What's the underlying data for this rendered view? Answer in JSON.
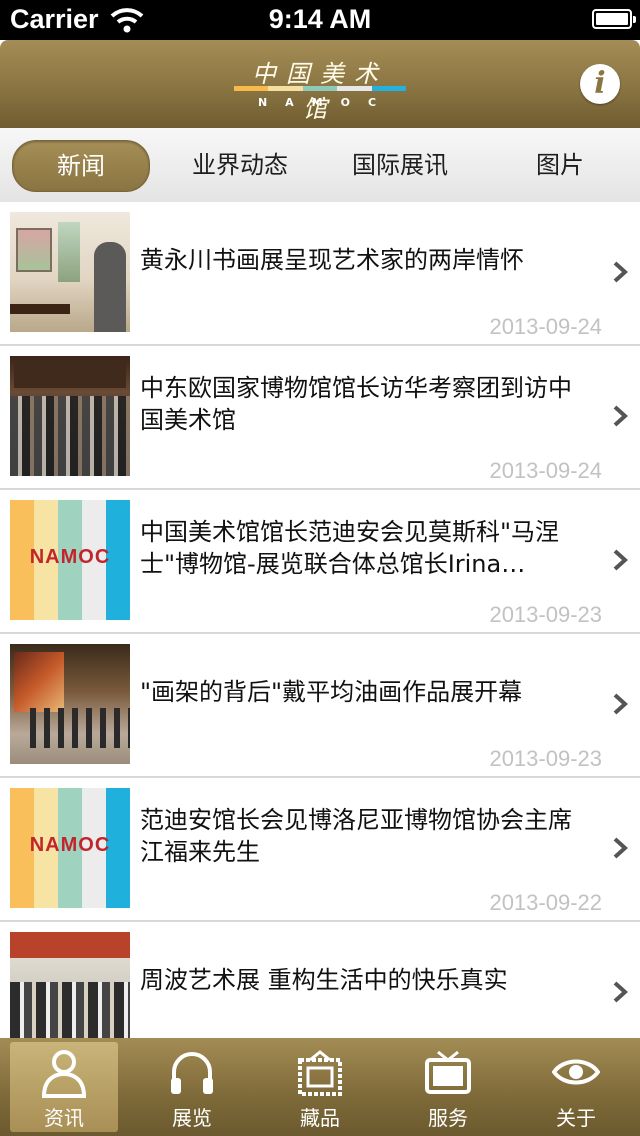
{
  "status_bar": {
    "carrier": "Carrier",
    "time": "9:14 AM"
  },
  "header": {
    "logo_cn": "中国美术馆",
    "logo_en": "NAMOC",
    "logo_stripe_colors": [
      "#f7b84c",
      "#f5dfa0",
      "#8fc9b8",
      "#e7e7e7",
      "#22b2dd"
    ],
    "info_icon": "info-icon"
  },
  "tabs": [
    {
      "label": "新闻",
      "active": true
    },
    {
      "label": "业界动态",
      "active": false
    },
    {
      "label": "国际展讯",
      "active": false
    },
    {
      "label": "图片",
      "active": false
    }
  ],
  "news": [
    {
      "title": "黄永川书画展呈现艺术家的两岸情怀",
      "date": "2013-09-24"
    },
    {
      "title": "中东欧国家博物馆馆长访华考察团到访中国美术馆",
      "date": "2013-09-24"
    },
    {
      "title": "中国美术馆馆长范迪安会见莫斯科\"马涅士\"博物馆-展览联合体总馆长Irina Zaytseva",
      "date": "2013-09-23"
    },
    {
      "title": "\"画架的背后\"戴平均油画作品展开幕",
      "date": "2013-09-23"
    },
    {
      "title": "范迪安馆长会见博洛尼亚博物馆协会主席江福来先生",
      "date": "2013-09-22"
    },
    {
      "title": "周波艺术展 重构生活中的快乐真实",
      "date": ""
    }
  ],
  "thumb_logo": {
    "word": "NAMOC",
    "stripe_colors": [
      "#f8bf5b",
      "#f7e3a3",
      "#9fd3c0",
      "#ececec",
      "#1fb0dc"
    ]
  },
  "tabbar": [
    {
      "label": "资讯",
      "icon": "person-icon",
      "active": true
    },
    {
      "label": "展览",
      "icon": "headphones-icon",
      "active": false
    },
    {
      "label": "藏品",
      "icon": "frame-icon",
      "active": false
    },
    {
      "label": "服务",
      "icon": "tv-icon",
      "active": false
    },
    {
      "label": "关于",
      "icon": "eye-icon",
      "active": false
    }
  ],
  "colors": {
    "brand_gold": "#8a7442",
    "date_gray": "#c2c2c2"
  }
}
